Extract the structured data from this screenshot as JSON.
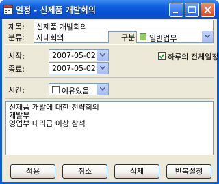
{
  "window": {
    "title": "일정 - 신제품 개발회의"
  },
  "form": {
    "subject_label": "제목:",
    "subject_value": "신제품 개발회의",
    "category_label": "분류:",
    "category_value": "사내회의",
    "type_label": "구분:",
    "type_value": "일반업무",
    "type_color": "#8fd05a",
    "start_label": "시작:",
    "start_value": "2007-05-02",
    "end_label": "종료:",
    "end_value": "2007-05-02",
    "allday_label": "하루의 전체일정",
    "allday_checked": true,
    "time_label": "시간:",
    "time_value": "여유있음",
    "time_checked": false,
    "memo_lines": [
      "신제품 개발에 대한 전략회의",
      "개발부",
      "영업부 대리급 이상 참석"
    ]
  },
  "buttons": {
    "apply": "적용",
    "cancel": "취소",
    "delete": "삭제",
    "repeat": "반복설정"
  }
}
